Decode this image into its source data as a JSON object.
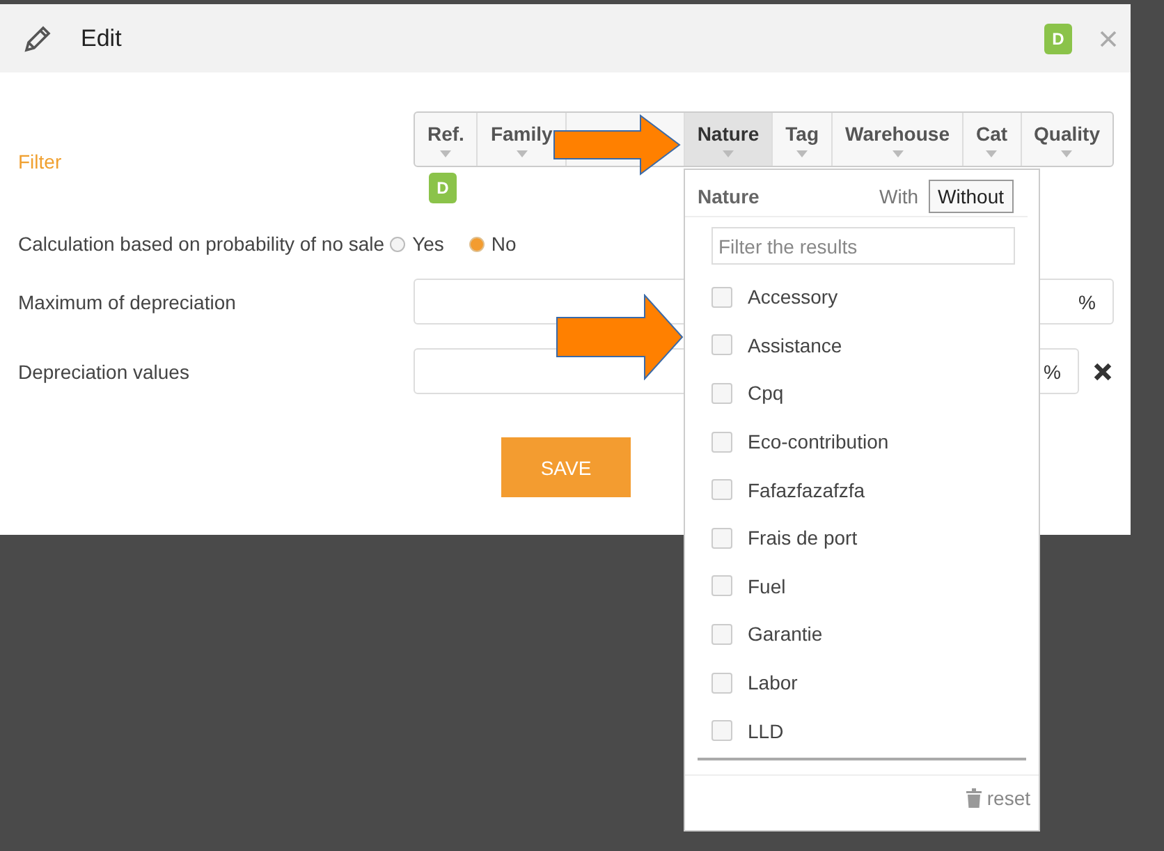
{
  "dialog": {
    "title": "Edit",
    "badge": "D"
  },
  "filter": {
    "label": "Filter",
    "badge": "D",
    "columns": [
      {
        "label": "Ref.",
        "selected": false
      },
      {
        "label": "Family",
        "selected": false
      },
      {
        "selected": false
      },
      {
        "label": "Nature",
        "selected": true
      },
      {
        "label": "Tag",
        "selected": false
      },
      {
        "label": "Warehouse",
        "selected": false
      },
      {
        "label": "Cat",
        "selected": false
      },
      {
        "label": "Quality",
        "selected": false
      }
    ]
  },
  "probability": {
    "label": "Calculation based on probability of no sale",
    "options": [
      {
        "label": "Yes",
        "selected": false
      },
      {
        "label": "No",
        "selected": true
      }
    ]
  },
  "max_depreciation": {
    "label": "Maximum of depreciation",
    "unit": "%"
  },
  "depreciation_values": {
    "label": "Depreciation values",
    "unit": "%"
  },
  "save": "SAVE",
  "dropdown": {
    "title": "Nature",
    "modes": [
      {
        "label": "With",
        "selected": false
      },
      {
        "label": "Without",
        "selected": true
      }
    ],
    "search": {
      "placeholder": "Filter the results"
    },
    "items": [
      {
        "label": "Accessory",
        "checked": false
      },
      {
        "label": "Assistance",
        "checked": false
      },
      {
        "label": "Cpq",
        "checked": false
      },
      {
        "label": "Eco-contribution",
        "checked": false
      },
      {
        "label": "Fafazfazafzfa",
        "checked": false
      },
      {
        "label": "Frais de port",
        "checked": false
      },
      {
        "label": "Fuel",
        "checked": false
      },
      {
        "label": "Garantie",
        "checked": false
      },
      {
        "label": "Labor",
        "checked": false
      },
      {
        "label": "LLD",
        "checked": false
      }
    ],
    "reset": "reset"
  }
}
